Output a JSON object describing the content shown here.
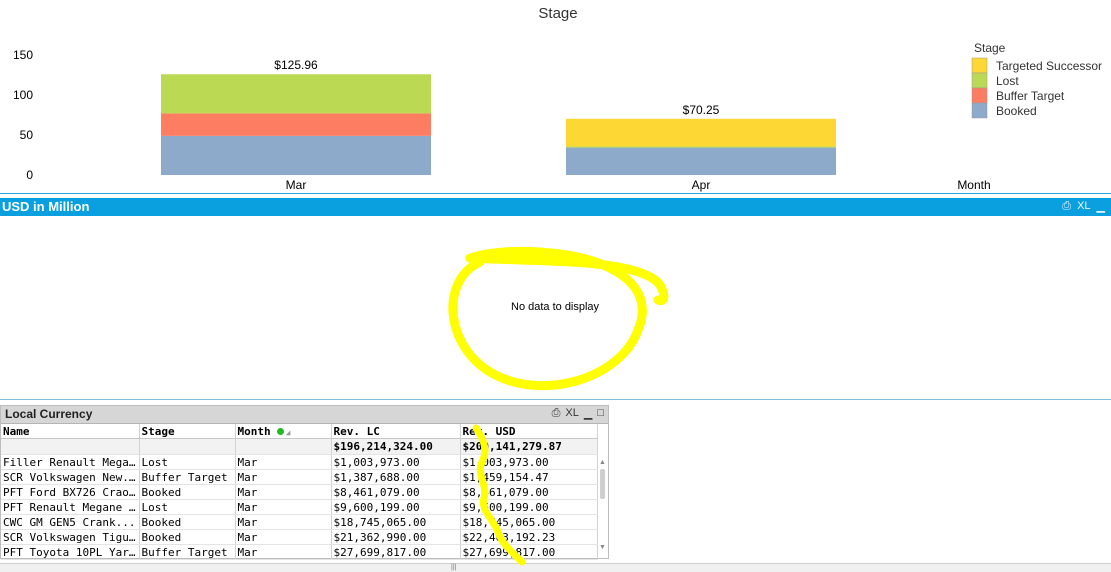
{
  "chart_data": {
    "type": "bar",
    "stacked": true,
    "title": "Stage",
    "xlabel": "Month",
    "categories": [
      "Mar",
      "Apr"
    ],
    "ylim": [
      0,
      150
    ],
    "yticks": [
      0,
      50,
      100,
      150
    ],
    "series": [
      {
        "name": "Booked",
        "color": "#8eaacb",
        "values": [
          48.9,
          34.3
        ]
      },
      {
        "name": "Buffer Target",
        "color": "#fd7d62",
        "values": [
          28.1,
          0
        ]
      },
      {
        "name": "Lost",
        "color": "#bcd953",
        "values": [
          48.96,
          1.4
        ]
      },
      {
        "name": "Targeted Successor",
        "color": "#fdd835",
        "values": [
          0,
          34.55
        ]
      }
    ],
    "totals": [
      "$125.96",
      "$70.25"
    ],
    "legend_title": "Stage",
    "legend_order": [
      "Targeted Successor",
      "Lost",
      "Buffer Target",
      "Booked"
    ],
    "legend_position": "right",
    "grid": false
  },
  "usd_panel": {
    "title": "USD in Million",
    "controls": [
      "⎙",
      "XL",
      "▁"
    ],
    "message": "No data to display"
  },
  "lc_panel": {
    "title": "Local Currency",
    "controls": [
      "⎙",
      "XL",
      "▁",
      "□"
    ],
    "columns": [
      "Name",
      "Stage",
      "Month",
      "Rev. LC",
      "Rev. USD"
    ],
    "totals": [
      "",
      "",
      "",
      "$196,214,324.00",
      "$200,141,279.87"
    ],
    "rows": [
      [
        "Filler Renault Megane...",
        "Lost",
        "Mar",
        "$1,003,973.00",
        "$1,003,973.00"
      ],
      [
        "SCR Volkswagen New...",
        "Buffer Target",
        "Mar",
        "$1,387,688.00",
        "$1,459,154.47"
      ],
      [
        "PFT Ford BX726 Crao...",
        "Booked",
        "Mar",
        "$8,461,079.00",
        "$8,461,079.00"
      ],
      [
        "PFT Renault Megane ...",
        "Lost",
        "Mar",
        "$9,600,199.00",
        "$9,600,199.00"
      ],
      [
        "CWC GM GEN5 Crank...",
        "Booked",
        "Mar",
        "$18,745,065.00",
        "$18,745,065.00"
      ],
      [
        "SCR Volkswagen Tigu...",
        "Booked",
        "Mar",
        "$21,362,990.00",
        "$22,463,192.23"
      ],
      [
        "PFT Toyota 10PL Yaris...",
        "Buffer Target",
        "Mar",
        "$27,699,817.00",
        "$27,699,817.00"
      ]
    ]
  },
  "colors": {
    "panel_header_blue": "#0aa0e0",
    "highlight_marker": "#ffff00"
  }
}
